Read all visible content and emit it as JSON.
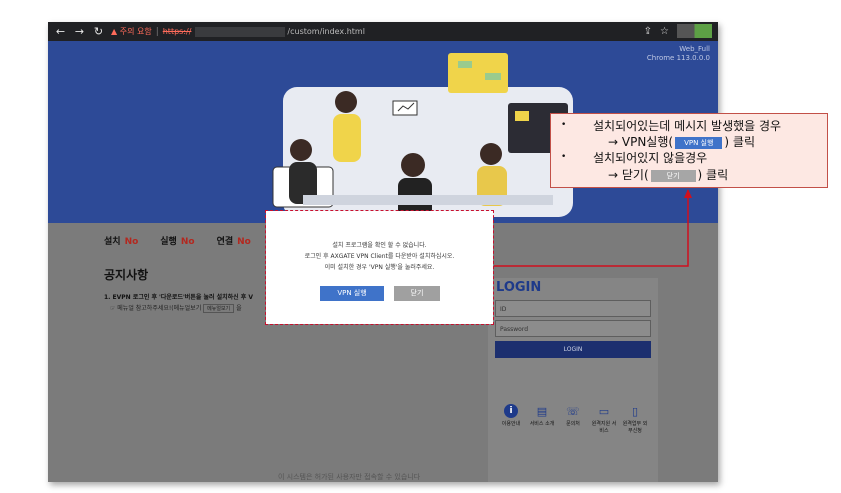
{
  "browser": {
    "warning": "주의 요함",
    "url_scheme": "https://",
    "url_path": "/custom/index.html"
  },
  "hero": {
    "ua_line1": "Web_Full",
    "ua_line2": "Chrome 113.0.0.0"
  },
  "status": [
    {
      "label": "설치",
      "value": "No"
    },
    {
      "label": "실행",
      "value": "No"
    },
    {
      "label": "연결",
      "value": "No"
    }
  ],
  "notice": {
    "title": "공지사항",
    "item1": "1. EVPN 로그인 후 '다운로드'버튼을 눌러 설치하신 후 V",
    "item2_pre": "☞ 메뉴얼 참고하주세요!(메뉴얼보기",
    "item2_box": "메뉴얼보기",
    "item2_post": "을"
  },
  "login": {
    "title": "LOGIN",
    "id_placeholder": "ID",
    "pw_placeholder": "Password",
    "button": "LOGIN",
    "icons": [
      {
        "icon": "info-icon",
        "glyph": "i",
        "label": "이용안내"
      },
      {
        "icon": "document-icon",
        "glyph": "▤",
        "label": "서비스 소개"
      },
      {
        "icon": "phone-icon",
        "glyph": "☏",
        "label": "문의처"
      },
      {
        "icon": "monitor-icon",
        "glyph": "▭",
        "label": "원격지원 서비스"
      },
      {
        "icon": "remote-icon",
        "glyph": "▯",
        "label": "원격업무 외부신청"
      }
    ]
  },
  "footer": "이 시스템은 허가된 사용자만 접속할 수 있습니다",
  "modal": {
    "line1": "설치 프로그램을 확인 할 수 없습니다.",
    "line2": "로그인 후 AXGATE VPN Client를 다운받아 설치하십시오.",
    "line3": "이미 설치한 경우 'VPN 실행'을 눌러주세요.",
    "vpn_button": "VPN 실행",
    "close_button": "닫기"
  },
  "callout": {
    "bullet": "•",
    "line1": "설치되어있는데 메시지 발생했을 경우",
    "line2_pre": "→ VPN실행(",
    "line2_post": ") 클릭",
    "line3": "설치되어있지 않을경우",
    "line4_pre": "→ 닫기(",
    "line4_post": ") 클릭",
    "pill_vpn": "VPN 실행",
    "pill_close": "닫기"
  },
  "colors": {
    "hero": "#2d4a97",
    "accent": "#3f73c9",
    "alert": "#c8102e"
  }
}
